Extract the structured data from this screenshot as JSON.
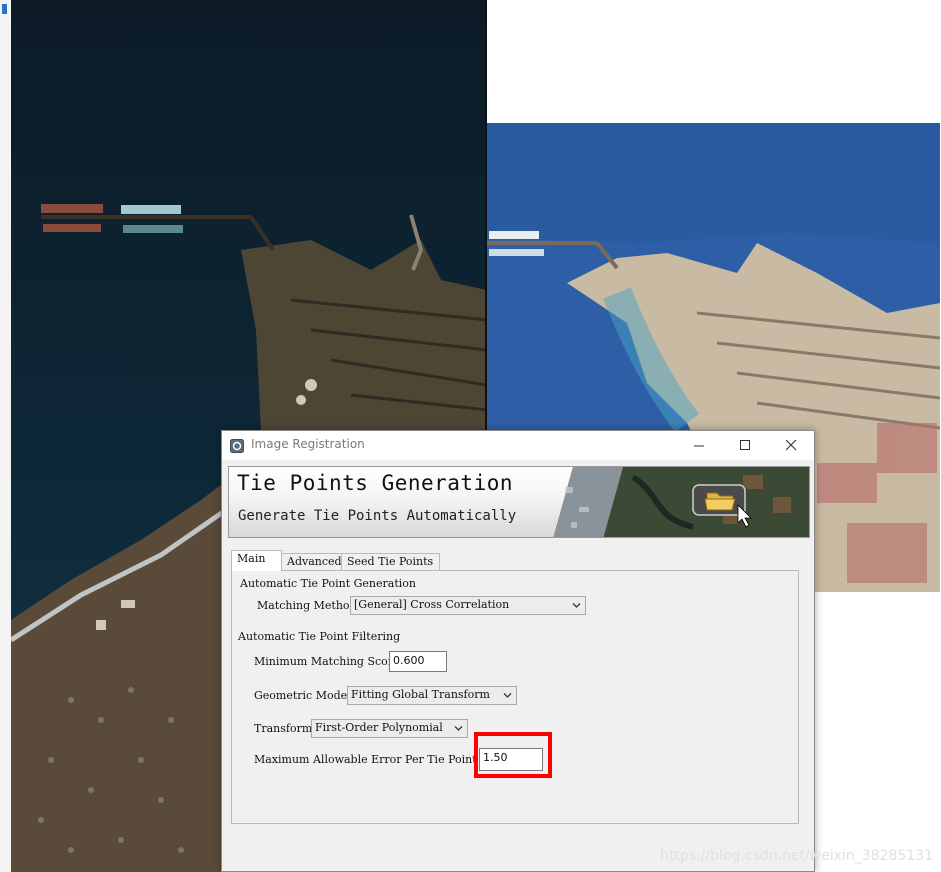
{
  "dialog": {
    "title": "Image Registration",
    "banner": {
      "heading": "Tie Points Generation",
      "subheading": "Generate Tie Points Automatically"
    },
    "tabs": [
      {
        "label": "Main",
        "active": true
      },
      {
        "label": "Advanced",
        "active": false
      },
      {
        "label": "Seed Tie Points",
        "active": false
      }
    ],
    "main": {
      "generation_section": "Automatic Tie Point Generation",
      "matching_method": {
        "label": "Matching Method",
        "value": "[General] Cross Correlation"
      },
      "filtering_section": "Automatic Tie Point Filtering",
      "min_matching_score": {
        "label": "Minimum Matching Score",
        "value": "0.600"
      },
      "geometric_model": {
        "label": "Geometric Model",
        "value": "Fitting Global Transform"
      },
      "transform": {
        "label": "Transform",
        "value": "First-Order Polynomial"
      },
      "max_error": {
        "label": "Maximum Allowable Error Per Tie Point",
        "value": "1.50"
      }
    }
  },
  "annotation": {
    "highlight_color": "#ff0000"
  },
  "watermark": "https://blog.csdn.net/weixin_38285131",
  "icons": [
    "app-icon",
    "minimize-icon",
    "maximize-icon",
    "close-icon",
    "folder-icon",
    "cursor-icon",
    "chevron-down-icon"
  ]
}
